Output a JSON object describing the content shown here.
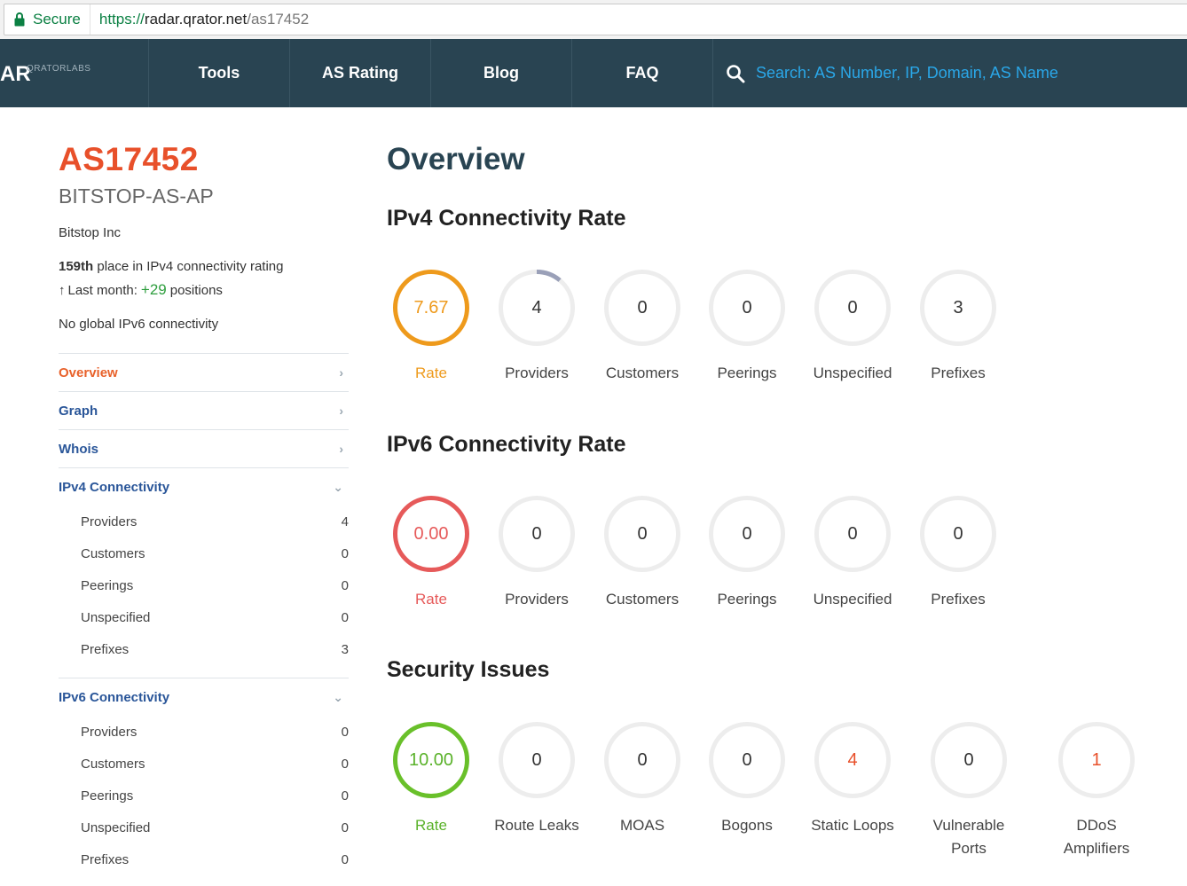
{
  "browser": {
    "secure_label": "Secure",
    "url_scheme": "https://",
    "url_host": "radar.qrator.net",
    "url_path": "/as17452"
  },
  "nav": {
    "logo_big": "AR",
    "logo_small": "QRATORLABS",
    "items": [
      "Tools",
      "AS Rating",
      "Blog",
      "FAQ"
    ],
    "search_placeholder": "Search: AS Number, IP, Domain, AS Name"
  },
  "sidebar": {
    "as_number": "AS17452",
    "as_name": "BITSTOP-AS-AP",
    "org": "Bitstop Inc",
    "place": "159th",
    "place_suffix": " place in IPv4 connectivity rating",
    "last_month_arrow": "↑",
    "last_month_label": "Last month:",
    "last_month_delta": "+29",
    "last_month_suffix": "positions",
    "ipv6_note": "No global IPv6 connectivity",
    "menu": {
      "overview": "Overview",
      "graph": "Graph",
      "whois": "Whois",
      "ipv4": "IPv4 Connectivity",
      "ipv6": "IPv6 Connectivity",
      "chev_right": "›",
      "chev_down": "⌄"
    },
    "ipv4_items": [
      {
        "label": "Providers",
        "count": "4"
      },
      {
        "label": "Customers",
        "count": "0"
      },
      {
        "label": "Peerings",
        "count": "0"
      },
      {
        "label": "Unspecified",
        "count": "0"
      },
      {
        "label": "Prefixes",
        "count": "3"
      }
    ],
    "ipv6_items": [
      {
        "label": "Providers",
        "count": "0"
      },
      {
        "label": "Customers",
        "count": "0"
      },
      {
        "label": "Peerings",
        "count": "0"
      },
      {
        "label": "Unspecified",
        "count": "0"
      },
      {
        "label": "Prefixes",
        "count": "0"
      }
    ]
  },
  "main": {
    "title": "Overview",
    "ipv4": {
      "heading": "IPv4 Connectivity Rate",
      "rate": "7.67",
      "rate_label": "Rate",
      "providers": "4",
      "providers_label": "Providers",
      "customers": "0",
      "customers_label": "Customers",
      "peerings": "0",
      "peerings_label": "Peerings",
      "unspecified": "0",
      "unspecified_label": "Unspecified",
      "prefixes": "3",
      "prefixes_label": "Prefixes"
    },
    "ipv6": {
      "heading": "IPv6 Connectivity Rate",
      "rate": "0.00",
      "rate_label": "Rate",
      "providers": "0",
      "providers_label": "Providers",
      "customers": "0",
      "customers_label": "Customers",
      "peerings": "0",
      "peerings_label": "Peerings",
      "unspecified": "0",
      "unspecified_label": "Unspecified",
      "prefixes": "0",
      "prefixes_label": "Prefixes"
    },
    "security": {
      "heading": "Security Issues",
      "rate": "10.00",
      "rate_label": "Rate",
      "route_leaks": "0",
      "route_leaks_label": "Route Leaks",
      "moas": "0",
      "moas_label": "MOAS",
      "bogons": "0",
      "bogons_label": "Bogons",
      "static_loops": "4",
      "static_loops_label": "Static Loops",
      "vulnerable_ports": "0",
      "vulnerable_ports_label_1": "Vulnerable",
      "vulnerable_ports_label_2": "Ports",
      "ddos": "1",
      "ddos_label_1": "DDoS",
      "ddos_label_2": "Amplifiers"
    }
  },
  "colors": {
    "nav_bg": "#294452",
    "accent_orange": "#e8502a",
    "rate_orange": "#ee9a1c",
    "rate_red": "#e65a5a",
    "rate_green": "#69c02a",
    "link_blue": "#2a5699",
    "search_blue": "#2aa7e8"
  }
}
